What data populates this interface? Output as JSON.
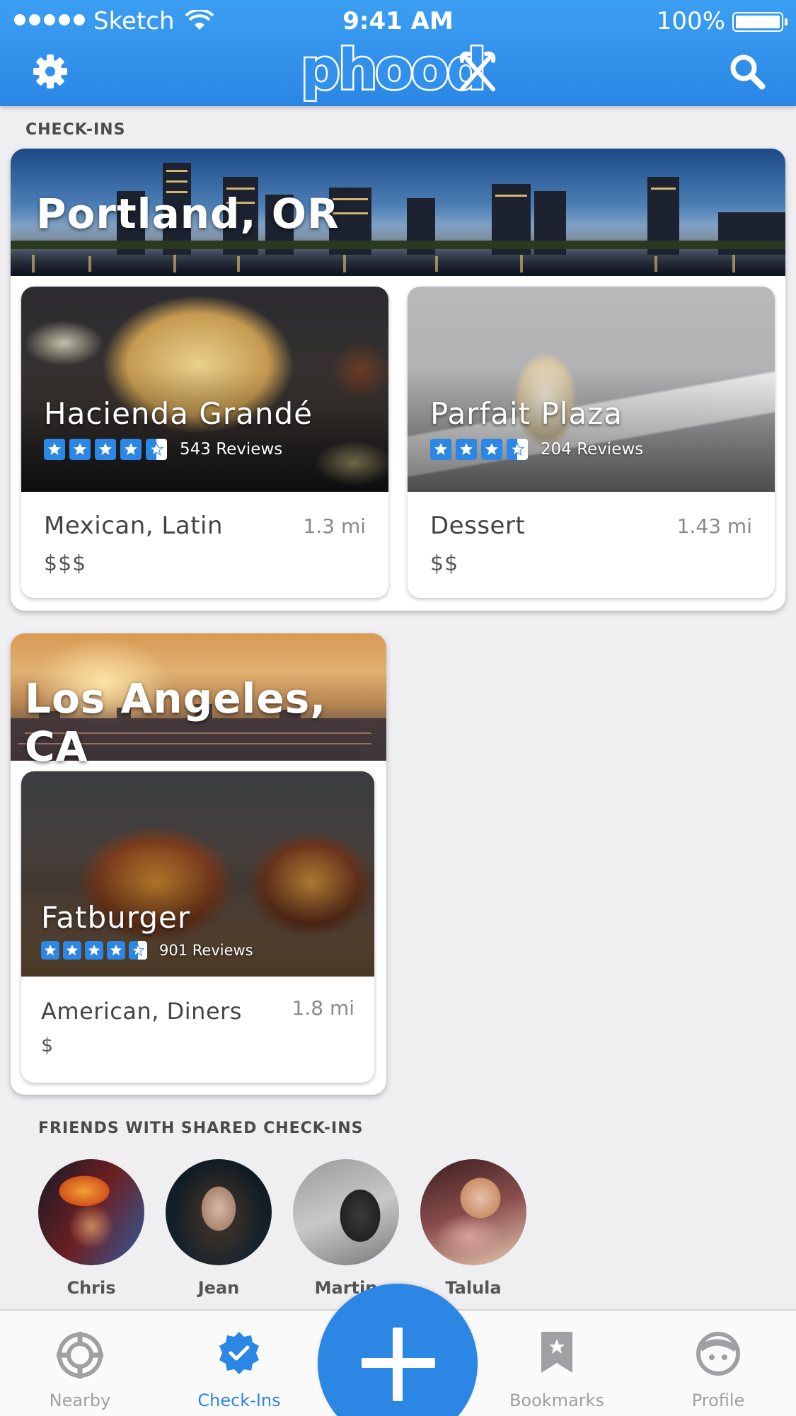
{
  "status_bar": {
    "carrier": "Sketch",
    "time": "9:41 AM",
    "battery": "100%"
  },
  "header": {
    "logo_text": "phood"
  },
  "checkins": {
    "section_title": "CHECK-INS",
    "cities": [
      {
        "name": "Portland, OR",
        "restaurants": [
          {
            "name": "Hacienda Grandé",
            "rating": 4.5,
            "reviews": "543 Reviews",
            "cuisine": "Mexican, Latin",
            "distance": "1.3 mi",
            "price": "$$$"
          },
          {
            "name": "Parfait Plaza",
            "rating": 3.5,
            "reviews": "204 Reviews",
            "cuisine": "Dessert",
            "distance": "1.43 mi",
            "price": "$$"
          }
        ]
      },
      {
        "name": "Los Angeles, CA",
        "restaurants": [
          {
            "name": "Fatburger",
            "rating": 4.5,
            "reviews": "901 Reviews",
            "cuisine": "American, Diners",
            "distance": "1.8 mi",
            "price": "$"
          }
        ]
      }
    ]
  },
  "friends": {
    "section_title": "FRIENDS WITH SHARED CHECK-INS",
    "people": [
      {
        "name": "Chris"
      },
      {
        "name": "Jean"
      },
      {
        "name": "Martin"
      },
      {
        "name": "Talula"
      }
    ]
  },
  "tabbar": {
    "items": [
      {
        "label": "Nearby",
        "icon": "crosshair-icon",
        "active": false
      },
      {
        "label": "Check-Ins",
        "icon": "badge-check-icon",
        "active": true
      },
      {
        "label": "Bookmarks",
        "icon": "bookmark-icon",
        "active": false
      },
      {
        "label": "Profile",
        "icon": "face-icon",
        "active": false
      }
    ],
    "fab_icon": "plus-icon"
  },
  "colors": {
    "accent": "#2b86e4",
    "header": "#3291ec",
    "background": "#efeff2"
  }
}
